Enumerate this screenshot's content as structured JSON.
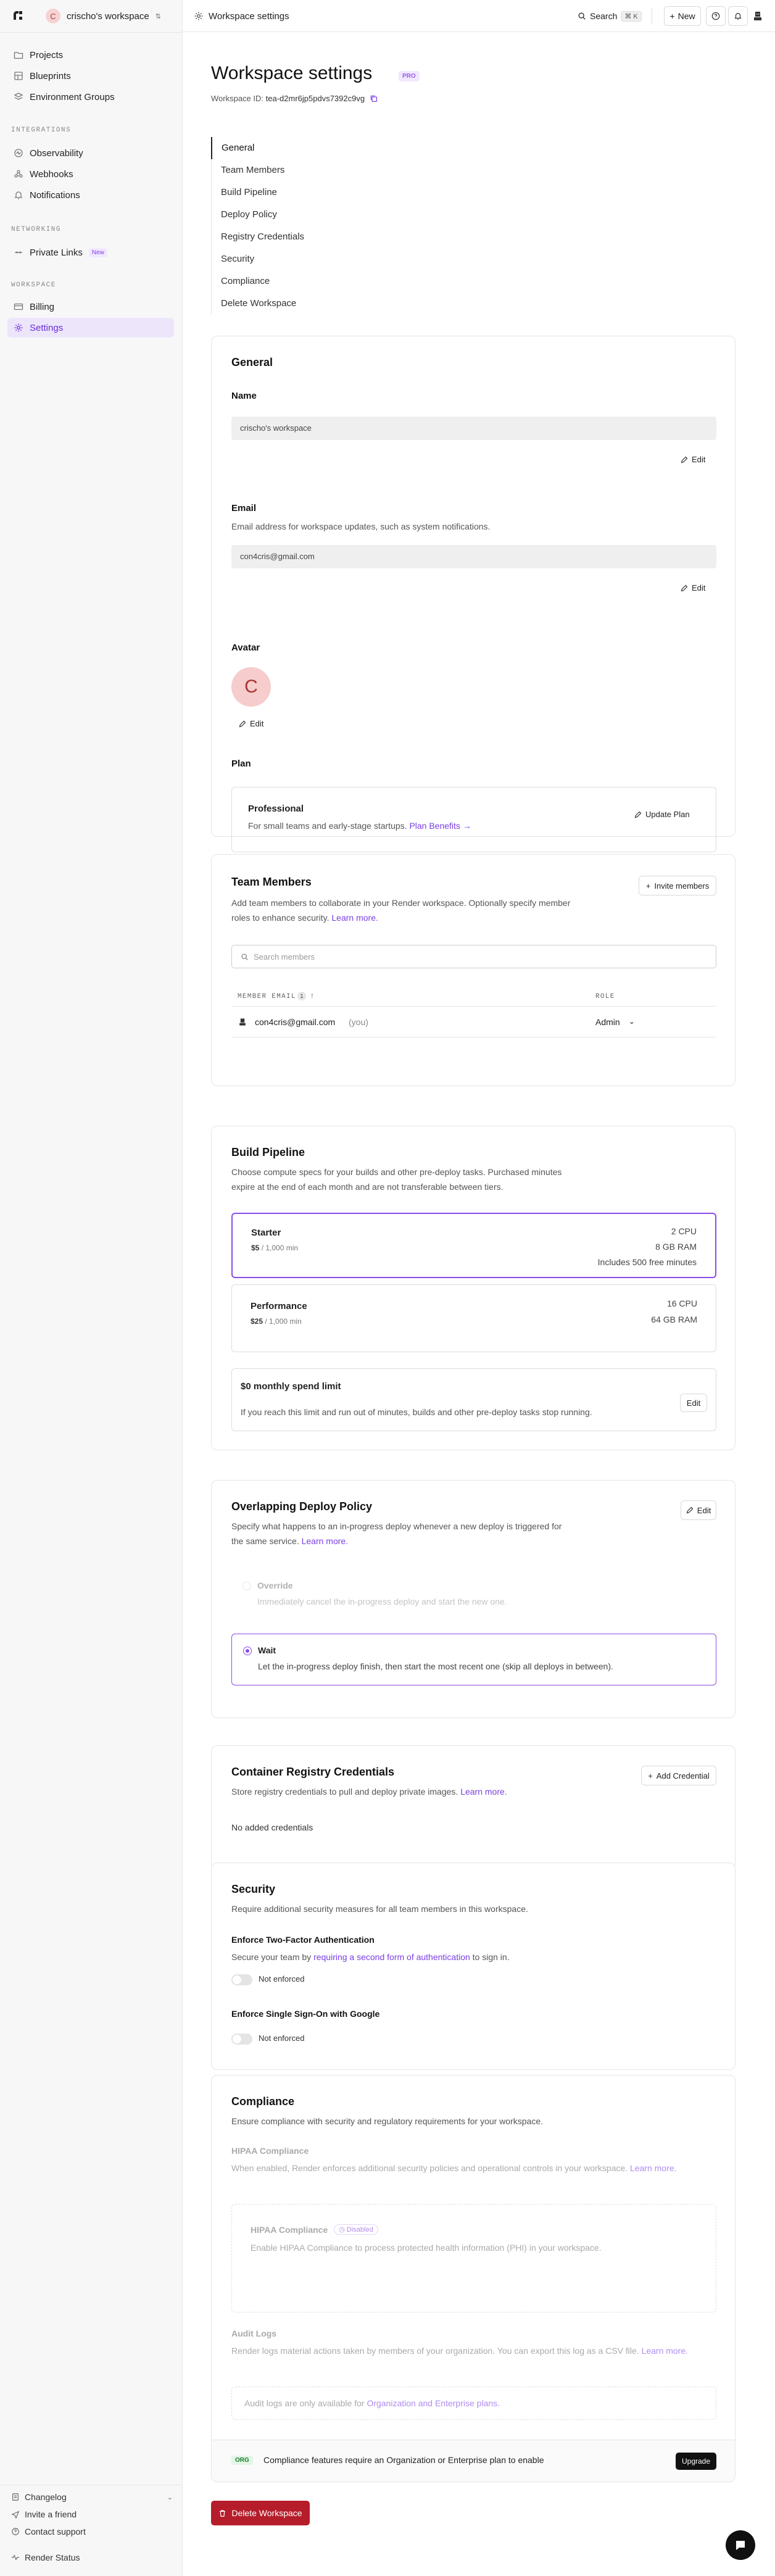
{
  "workspace": {
    "avatar_letter": "C",
    "name": "crischo's workspace"
  },
  "sidebar": {
    "items_top": [
      {
        "label": "Projects",
        "icon": "folder-icon"
      },
      {
        "label": "Blueprints",
        "icon": "blueprint-icon"
      },
      {
        "label": "Environment Groups",
        "icon": "layers-icon"
      }
    ],
    "section_integrations": "INTEGRATIONS",
    "items_integrations": [
      {
        "label": "Observability",
        "icon": "activity-icon"
      },
      {
        "label": "Webhooks",
        "icon": "webhook-icon"
      },
      {
        "label": "Notifications",
        "icon": "bell-icon"
      }
    ],
    "section_networking": "NETWORKING",
    "private_links": "Private Links",
    "new_badge": "New",
    "section_workspace": "WORKSPACE",
    "billing": "Billing",
    "settings": "Settings",
    "changelog": "Changelog",
    "invite": "Invite a friend",
    "support": "Contact support",
    "status": "Render Status"
  },
  "topbar": {
    "crumb": "Workspace settings",
    "search": "Search",
    "shortcut": "⌘ K",
    "new_label": "New"
  },
  "page": {
    "title": "Workspace settings",
    "badge": "PRO",
    "workspace_id_label": "Workspace ID:",
    "workspace_id": "tea-d2mr6jp5pdvs7392c9vg",
    "toc": [
      "General",
      "Team Members",
      "Build Pipeline",
      "Deploy Policy",
      "Registry Credentials",
      "Security",
      "Compliance",
      "Delete Workspace"
    ]
  },
  "general": {
    "title": "General",
    "name_label": "Name",
    "name_value": "crischo's workspace",
    "edit": "Edit",
    "email_label": "Email",
    "email_desc": "Email address for workspace updates, such as system notifications.",
    "email_value": "con4cris@gmail.com",
    "avatar_label": "Avatar",
    "avatar_letter": "C",
    "plan_label": "Plan",
    "plan_name": "Professional",
    "plan_desc": "For small teams and early-stage startups.",
    "plan_link": "Plan Benefits →",
    "update_plan": "Update Plan"
  },
  "team": {
    "title": "Team Members",
    "desc": "Add team members to collaborate in your Render workspace. Optionally specify member roles to enhance security.",
    "learn": "Learn more.",
    "invite": "Invite members",
    "search_placeholder": "Search members",
    "col_email": "MEMBER EMAIL",
    "col_count": "1",
    "col_role": "ROLE",
    "member_email": "con4cris@gmail.com",
    "member_you": "(you)",
    "member_role": "Admin"
  },
  "build": {
    "title": "Build Pipeline",
    "desc": "Choose compute specs for your builds and other pre-deploy tasks. Purchased minutes expire at the end of each month and are not transferable between tiers.",
    "starter_name": "Starter",
    "starter_price": "$5",
    "starter_unit": "/ 1,000 min",
    "starter_cpu": "2 CPU",
    "starter_ram": "8 GB RAM",
    "starter_free": "Includes 500 free minutes",
    "perf_name": "Performance",
    "perf_price": "$25",
    "perf_unit": "/ 1,000 min",
    "perf_cpu": "16 CPU",
    "perf_ram": "64 GB RAM",
    "limit_title": "$0 monthly spend limit",
    "limit_desc": "If you reach this limit and run out of minutes, builds and other pre-deploy tasks stop running.",
    "edit": "Edit"
  },
  "deploy": {
    "title": "Overlapping Deploy Policy",
    "desc": "Specify what happens to an in-progress deploy whenever a new deploy is triggered for the same service.",
    "learn": "Learn more.",
    "edit": "Edit",
    "override_title": "Override",
    "override_desc": "Immediately cancel the in-progress deploy and start the new one.",
    "wait_title": "Wait",
    "wait_desc": "Let the in-progress deploy finish, then start the most recent one (skip all deploys in between)."
  },
  "registry": {
    "title": "Container Registry Credentials",
    "desc": "Store registry credentials to pull and deploy private images.",
    "learn": "Learn more.",
    "add": "Add Credential",
    "empty": "No added credentials"
  },
  "security": {
    "title": "Security",
    "desc": "Require additional security measures for all team members in this workspace.",
    "tfa_title": "Enforce Two-Factor Authentication",
    "tfa_desc_pre": "Secure your team by",
    "tfa_link": "requiring a second form of authentication",
    "tfa_desc_post": "to sign in.",
    "tfa_state": "Not enforced",
    "sso_title": "Enforce Single Sign-On with Google",
    "sso_state": "Not enforced"
  },
  "compliance": {
    "title": "Compliance",
    "desc": "Ensure compliance with security and regulatory requirements for your workspace.",
    "hipaa_title": "HIPAA Compliance",
    "hipaa_desc": "When enabled, Render enforces additional security policies and operational controls in your workspace.",
    "learn": "Learn more.",
    "hipaa_box_title": "HIPAA Compliance",
    "disabled": "Disabled",
    "hipaa_box_desc": "Enable HIPAA Compliance to process protected health information (PHI) in your workspace.",
    "audit_title": "Audit Logs",
    "audit_desc": "Render logs material actions taken by members of your organization. You can export this log as a CSV file.",
    "audit_box_pre": "Audit logs are only available for",
    "audit_box_link": "Organization and Enterprise plans.",
    "org_badge": "ORG",
    "org_text": "Compliance features require an Organization or Enterprise plan to enable",
    "upgrade": "Upgrade"
  },
  "delete_label": "Delete Workspace"
}
